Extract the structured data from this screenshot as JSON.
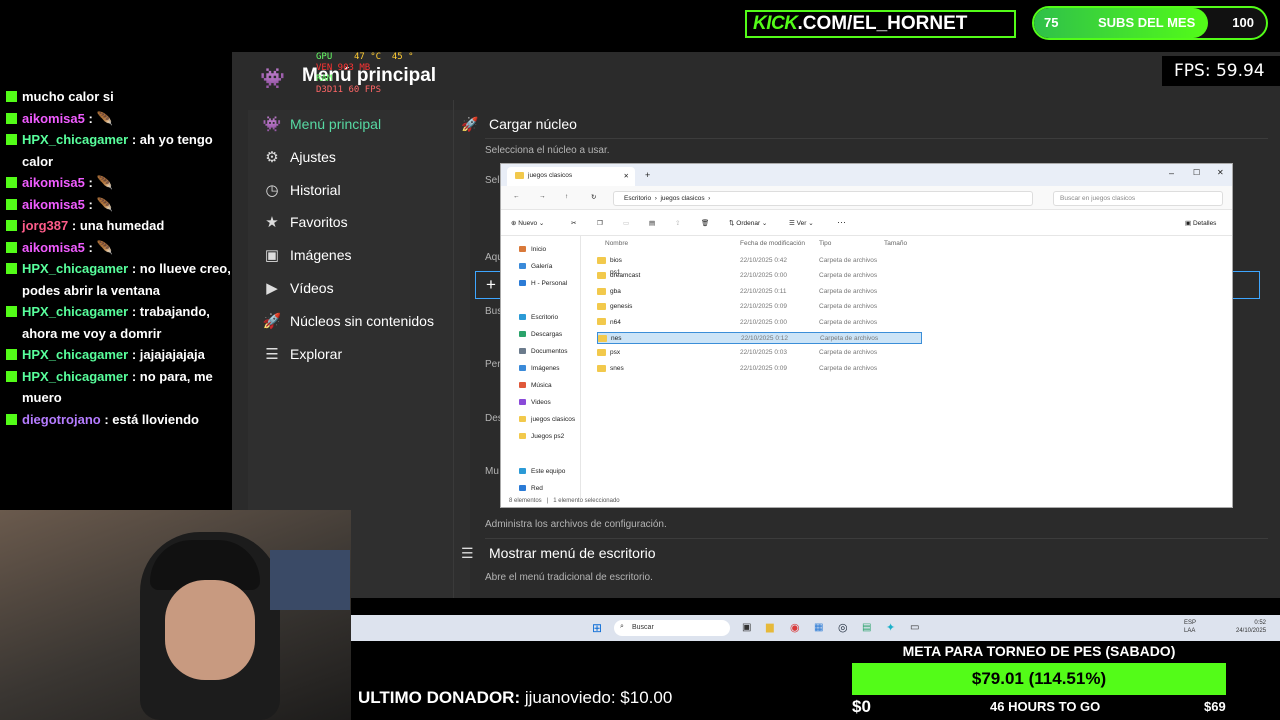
{
  "overlay": {
    "kick_prefix": "KICK",
    "kick_rest": ".COM/EL_HORNET",
    "subs_current": "75",
    "subs_label": "SUBS DEL MES",
    "subs_goal": "100",
    "subs_fraction": 0.75,
    "fps": "FPS: 59.94"
  },
  "hud": {
    "l1a": "GPU",
    "l1b": "47 °C",
    "l1c": "45 °",
    "l2": "VEN  903 MB",
    "l3": "RAM",
    "l4": "D3D11   60 FPS"
  },
  "chat": [
    {
      "user": "",
      "text": "mucho calor si",
      "ucls": "u2"
    },
    {
      "user": "aikomisa5",
      "text": ": 🪶",
      "ucls": "u1"
    },
    {
      "user": "HPX_chicagamer",
      "text": ": ah yo tengo calor",
      "ucls": "u4"
    },
    {
      "user": "aikomisa5",
      "text": ": 🪶",
      "ucls": "u1"
    },
    {
      "user": "aikomisa5",
      "text": ": 🪶",
      "ucls": "u1"
    },
    {
      "user": "jorg387",
      "text": ": una humedad",
      "ucls": "u3"
    },
    {
      "user": "aikomisa5",
      "text": ": 🪶",
      "ucls": "u1"
    },
    {
      "user": "HPX_chicagamer",
      "text": ": no llueve creo, podes abrir la ventana",
      "ucls": "u4"
    },
    {
      "user": "HPX_chicagamer",
      "text": ": trabajando, ahora me voy a domrir",
      "ucls": "u4"
    },
    {
      "user": "HPX_chicagamer",
      "text": ": jajajajajaja",
      "ucls": "u4"
    },
    {
      "user": "HPX_chicagamer",
      "text": ": no para, me muero",
      "ucls": "u4"
    },
    {
      "user": "diegotrojano",
      "text": ": está lloviendo",
      "ucls": "u5"
    }
  ],
  "retroarch": {
    "title": "Menú principal",
    "menu": [
      "Menú principal",
      "Ajustes",
      "Historial",
      "Favoritos",
      "Imágenes",
      "Vídeos",
      "Núcleos sin contenidos",
      "Explorar"
    ],
    "menu_icons": [
      "invader-icon",
      "gear-icon",
      "history-icon",
      "star-icon",
      "image-icon",
      "video-icon",
      "rocket-icon",
      "database-icon"
    ],
    "load_core": "Cargar núcleo",
    "load_core_desc": "Selecciona el núcleo a usar.",
    "config_desc": "Administra los archivos de configuración.",
    "desktop_menu": "Mostrar menú de escritorio",
    "desktop_desc": "Abre el menú tradicional de escritorio.",
    "clipped": [
      "Sele",
      "Aqu",
      "Bus",
      "Per",
      "Des",
      "Mu"
    ]
  },
  "explorer": {
    "tab": "juegos clasicos",
    "breadcrumb": [
      "Escritorio",
      "juegos clasicos"
    ],
    "search": "Buscar en juegos clasicos",
    "cmd": [
      "Nuevo",
      "Ordenar",
      "Ver",
      "Detalles"
    ],
    "cols": [
      "Nombre",
      "Fecha de modificación",
      "Tipo",
      "Tamaño"
    ],
    "nav": [
      {
        "label": "Inicio",
        "color": "#d9793a"
      },
      {
        "label": "Galería",
        "color": "#3a8ad9"
      },
      {
        "label": "H - Personal",
        "color": "#2b7bd6"
      },
      {
        "label": "Escritorio",
        "color": "#2b9ad6"
      },
      {
        "label": "Descargas",
        "color": "#2aa36b"
      },
      {
        "label": "Documentos",
        "color": "#6b7b8c"
      },
      {
        "label": "Imágenes",
        "color": "#3a8ad9"
      },
      {
        "label": "Música",
        "color": "#e0583a"
      },
      {
        "label": "Videos",
        "color": "#8a4ad9"
      },
      {
        "label": "juegos clasicos",
        "color": "#f2c94c"
      },
      {
        "label": "Juegos ps2",
        "color": "#f2c94c"
      },
      {
        "label": "Este equipo",
        "color": "#2b9ad6"
      },
      {
        "label": "Red",
        "color": "#2b7bd6"
      }
    ],
    "files": [
      {
        "name": "bios ps1",
        "date": "22/10/2025 0:42",
        "type": "Carpeta de archivos"
      },
      {
        "name": "dreamcast",
        "date": "22/10/2025 0:00",
        "type": "Carpeta de archivos"
      },
      {
        "name": "gba",
        "date": "22/10/2025 0:11",
        "type": "Carpeta de archivos"
      },
      {
        "name": "genesis",
        "date": "22/10/2025 0:09",
        "type": "Carpeta de archivos"
      },
      {
        "name": "n64",
        "date": "22/10/2025 0:00",
        "type": "Carpeta de archivos"
      },
      {
        "name": "nes",
        "date": "22/10/2025 0:12",
        "type": "Carpeta de archivos"
      },
      {
        "name": "psx",
        "date": "22/10/2025 0:03",
        "type": "Carpeta de archivos"
      },
      {
        "name": "snes",
        "date": "22/10/2025 0:09",
        "type": "Carpeta de archivos"
      }
    ],
    "selected_index": 5,
    "status_count": "8 elementos",
    "status_sel": "1 elemento seleccionado"
  },
  "taskbar": {
    "search": "Buscar",
    "lang": "ESP",
    "kbd": "LAA",
    "time": "0:52",
    "date": "24/10/2025"
  },
  "donation": {
    "label": "ULTIMO DONADOR:",
    "donor": "jjuanoviedo: $10.00"
  },
  "goal": {
    "title": "META PARA TORNEO DE PES (SABADO)",
    "amount": "$79.01 (114.51%)",
    "start": "$0",
    "remaining": "46 HOURS TO GO",
    "target": "$69",
    "progress_fraction": 1.0
  }
}
